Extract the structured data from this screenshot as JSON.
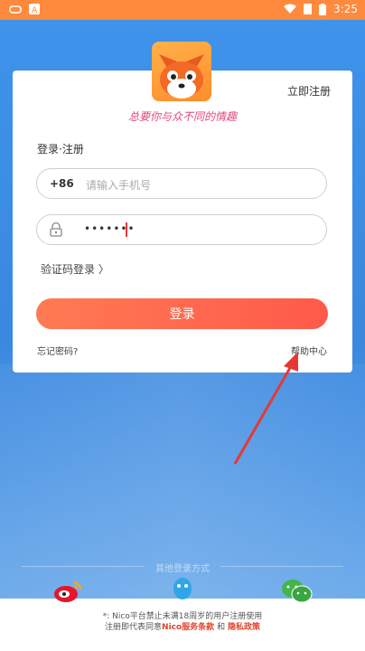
{
  "status_bar": {
    "time": "3:25"
  },
  "card": {
    "register_link": "立即注册",
    "slogan": "总要你与众不同的情趣",
    "tab_label": "登录·注册",
    "country_code": "+86",
    "phone_placeholder": "请输入手机号",
    "password_mask": "•••••••",
    "sms_login": "验证码登录 〉",
    "login_button": "登录",
    "forgot_password": "忘记密码?",
    "help_center": "帮助中心"
  },
  "other_login": {
    "label": "其他登录方式"
  },
  "notice": {
    "line1": "*: Nico平台禁止未满18周岁的用户注册使用",
    "line2_prefix": "注册即代表同意",
    "terms": "Nico服务条款",
    "and": "和",
    "privacy": "隐私政策"
  },
  "colors": {
    "status_bar": "#ff8a3d",
    "background": "#3d8ee6",
    "login_button": "#ff6a4f",
    "arrow": "#e53935"
  }
}
